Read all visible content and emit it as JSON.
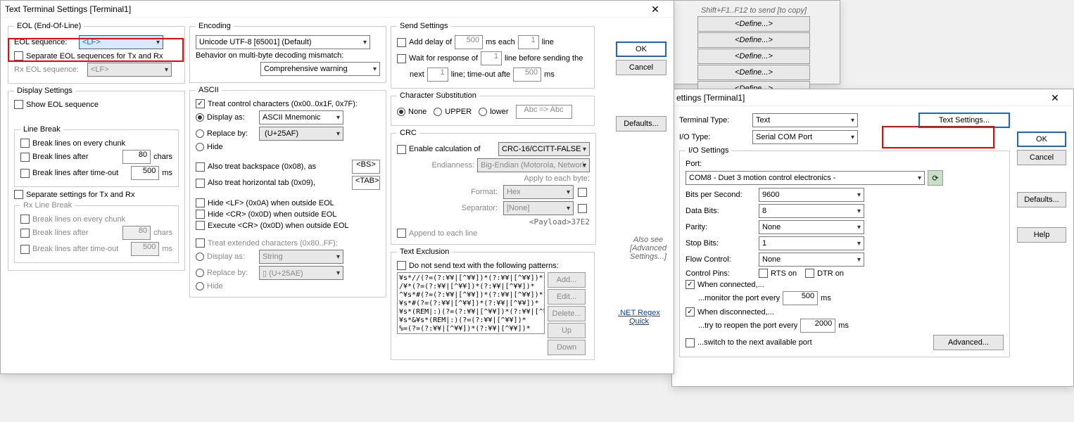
{
  "bg_hint": "Shift+F1..F12 to send [to copy]",
  "define_buttons": [
    "<Define...>",
    "<Define...>",
    "<Define...>",
    "<Define...>",
    "<Define...>"
  ],
  "win_text": {
    "title": "Text Terminal Settings [Terminal1]",
    "eol": {
      "legend": "EOL (End-Of-Line)",
      "eol_seq_label": "EOL sequence:",
      "eol_seq_value": "<LF>",
      "separate_tx_rx": "Separate EOL sequences for Tx and Rx",
      "rx_eol_label": "Rx EOL sequence:",
      "rx_eol_value": "<LF>"
    },
    "display": {
      "legend": "Display Settings",
      "show_eol": "Show EOL sequence",
      "line_break_legend": "Line Break",
      "break_every_chunk": "Break lines on every chunk",
      "break_after": "Break lines after",
      "break_after_val": "80",
      "break_after_unit": "chars",
      "break_timeout": "Break lines after time-out",
      "break_timeout_val": "500",
      "break_timeout_unit": "ms",
      "separate_tx_rx": "Separate settings for Tx and Rx",
      "rx_line_break_legend": "Rx Line Break",
      "rx_break_every_chunk": "Break lines on every chunk",
      "rx_break_after": "Break lines after",
      "rx_break_after_val": "80",
      "rx_break_after_unit": "chars",
      "rx_break_timeout": "Break lines after time-out",
      "rx_break_timeout_val": "500",
      "rx_break_timeout_unit": "ms"
    },
    "encoding": {
      "legend": "Encoding",
      "value": "Unicode UTF-8 [65001] (Default)",
      "mismatch_label": "Behavior on multi-byte decoding mismatch:",
      "mismatch_value": "Comprehensive warning"
    },
    "ascii": {
      "legend": "ASCII",
      "treat_control": "Treat control characters (0x00..0x1F, 0x7F):",
      "display_as": "Display as:",
      "display_as_val": "ASCII Mnemonic",
      "replace_by": "Replace by:",
      "replace_by_val": "␯ (U+25AF)",
      "hide": "Hide",
      "also_bs": "Also treat backspace (0x08), as",
      "also_bs_tag": "<BS>",
      "also_tab": "Also treat horizontal tab (0x09),",
      "also_tab_tag": "<TAB>",
      "hide_lf": "Hide <LF> (0x0A) when outside EOL",
      "hide_cr": "Hide <CR> (0x0D) when outside EOL",
      "exec_cr": "Execute <CR> (0x0D) when outside EOL",
      "treat_ext": "Treat extended characters (0x80..FF):",
      "display_as2_val": "String",
      "replace_by2_val": "▯ (U+25AE)",
      "hide2": "Hide"
    },
    "send": {
      "legend": "Send Settings",
      "add_delay": "Add delay of",
      "add_delay_val": "500",
      "add_delay_ms": "ms each",
      "add_delay_lines": "1",
      "add_delay_end": "line",
      "wait_resp": "Wait for response of",
      "wait_resp_lines": "1",
      "wait_resp_mid": "line before sending the",
      "wait_next": "next",
      "wait_next_lines": "1",
      "wait_after": "line;  time-out afte",
      "wait_timeout": "500",
      "wait_ms": "ms"
    },
    "charsub": {
      "legend": "Character Substitution",
      "none": "None",
      "upper": "UPPER",
      "lower": "lower",
      "example": "Abc => Abc"
    },
    "crc": {
      "legend": "CRC",
      "enable": "Enable calculation of",
      "algo": "CRC-16/CCITT-FALSE",
      "endian_lbl": "Endianness:",
      "endian_val": "Big-Endian (Motorola, Network",
      "apply_each": "Apply to each byte:",
      "format_lbl": "Format:",
      "format_val": "Hex",
      "sep_lbl": "Separator:",
      "sep_val": "[None]",
      "payload": "<Payload>37E2",
      "append": "Append to each line"
    },
    "texcl": {
      "legend": "Text Exclusion",
      "do_not_send": "Do not send text with the following patterns:",
      "patterns": "¥s*//(?=(?:¥¥|[^¥¥])*(?:¥¥|[^¥¥])*\n/¥*(?=(?:¥¥|[^¥¥])*(?:¥¥|[^¥¥])*\n^¥s*#(?=(?:¥¥|[^¥¥])*(?:¥¥|[^¥¥])*\n¥s*#(?=(?:¥¥|[^¥¥])*(?:¥¥|[^¥¥])*\n¥s*(REM|:)(?=(?:¥¥|[^¥¥])*(?:¥¥|[^¥¥])*\n¥s*&¥s*(REM|:)(?=(?:¥¥|[^¥¥])*\n%=(?=(?:¥¥|[^¥¥])*(?:¥¥|[^¥¥])*",
      "add": "Add...",
      "edit": "Edit...",
      "delete": "Delete...",
      "up": "Up",
      "down": "Down"
    },
    "ok": "OK",
    "cancel": "Cancel",
    "defaults": "Defaults...",
    "also_see": "Also see\n[Advanced\nSettings...]",
    "regex_link": ".NET Regex Quick"
  },
  "win_term": {
    "title": "ettings [Terminal1]",
    "term_type_lbl": "Terminal Type:",
    "term_type_val": "Text",
    "text_settings_btn": "Text Settings...",
    "io_type_lbl": "I/O Type:",
    "io_type_val": "Serial COM Port",
    "io_settings_legend": "I/O Settings",
    "port_lbl": "Port:",
    "port_val": "COM8 - Duet 3 motion control electronics - ",
    "bps_lbl": "Bits per Second:",
    "bps_val": "9600",
    "data_bits_lbl": "Data Bits:",
    "data_bits_val": "8",
    "parity_lbl": "Parity:",
    "parity_val": "None",
    "stop_bits_lbl": "Stop Bits:",
    "stop_bits_val": "1",
    "flow_lbl": "Flow Control:",
    "flow_val": "None",
    "ctrl_pins_lbl": "Control Pins:",
    "rts": "RTS on",
    "dtr": "DTR on",
    "when_conn": "When connected,...",
    "monitor": "...monitor the port every",
    "monitor_val": "500",
    "ms": "ms",
    "when_disc": "When disconnected,...",
    "reopen": "...try to reopen the port every",
    "reopen_val": "2000",
    "switch_next": "...switch to the next available port",
    "advanced": "Advanced...",
    "ok": "OK",
    "cancel": "Cancel",
    "defaults": "Defaults...",
    "help": "Help"
  }
}
